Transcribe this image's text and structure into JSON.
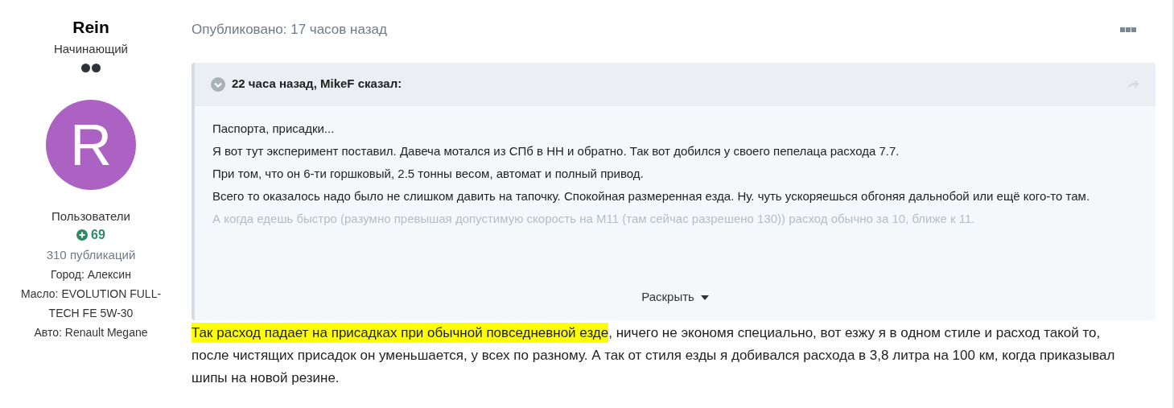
{
  "author": {
    "name": "Rein",
    "rank": "Начинающий",
    "avatar_letter": "R",
    "group": "Пользователи",
    "reputation": "69",
    "posts": "310 публикаций",
    "fields": [
      {
        "label": "Город:",
        "value": "Алексин"
      },
      {
        "label": "Масло:",
        "value": "EVOLUTION FULL-TECH FE 5W-30"
      },
      {
        "label": "Авто:",
        "value": "Renault Megane"
      }
    ]
  },
  "post": {
    "published": "Опубликовано: 17 часов назад",
    "quote": {
      "header": "22 часа назад, MikeF сказал:",
      "expanded": false,
      "paragraphs": [
        {
          "text": "Паспорта, присадки...",
          "faded": false
        },
        {
          "text": "Я вот тут эксперимент поставил. Давеча мотался из СПб в НН и обратно. Так вот добился у своего пепелаца расхода 7.7.",
          "faded": false
        },
        {
          "text": "При том, что он 6-ти горшковый, 2.5 тонны весом, автомат и полный привод.",
          "faded": false
        },
        {
          "text": "Всего то оказалось надо было не слишком давить на тапочку. Спокойная размеренная езда. Ну. чуть ускоряешься обгоняя дальнобой или ещё кого-то там.",
          "faded": false
        },
        {
          "text": "А когда едешь быстро (разумно превышая допустимую скорость на М11 (там сейчас разрешено 130)) расход обычно за 10, ближе к 11.",
          "faded": true
        }
      ],
      "expand_label": "Раскрыть"
    },
    "reply": {
      "highlighted": "Так расход падает на присадках при обычной повседневной езде",
      "text": ", ничего не экономя специально, вот езжу я в одном стиле и расход такой то, после чистящих присадок он уменьшается, у всех по разному. А так от стиля езды я добивался расхода в 3,8 литра на 100 км, когда приказывал шипы на новой резине."
    }
  }
}
